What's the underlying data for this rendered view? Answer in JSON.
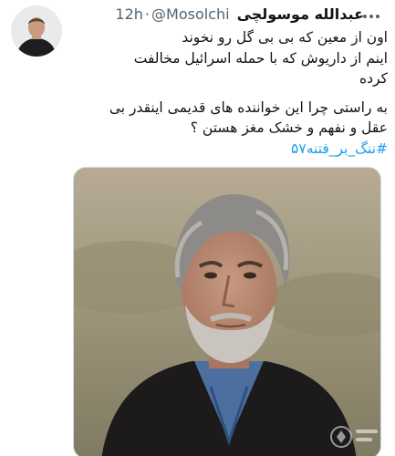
{
  "tweet": {
    "display_name": "عبدالله موسولچی",
    "handle": "@Mosolchi",
    "separator": "·",
    "time": "12h",
    "lines": [
      "اون از معین که بی بی گل رو نخوند",
      "اینم از داریوش که با حمله اسرائیل مخالفت",
      "کرده",
      "به راستی چرا این خواننده های قدیمی اینقدر بی",
      "عقل و نفهم و خشک مغز هستن ؟"
    ],
    "hashtag": "#ننگ_بر_فتنه۵۷"
  },
  "icons": {
    "more": "more-horizontal-icon",
    "watermark": "watermark-logo"
  },
  "colors": {
    "link": "#1d9bf0",
    "secondary_text": "#536471",
    "primary_text": "#0f1419"
  }
}
